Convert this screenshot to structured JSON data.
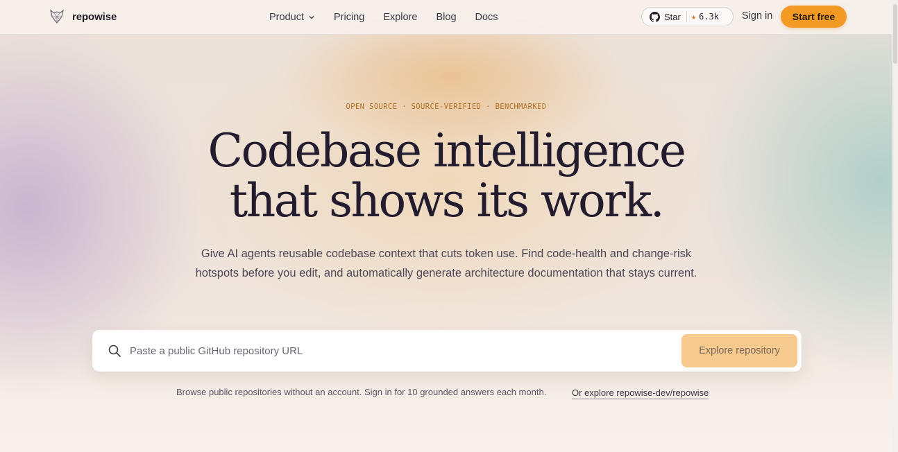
{
  "brand": {
    "name": "repowise",
    "logo_icon": "wolf-logo-icon"
  },
  "nav": {
    "links": [
      {
        "label": "Product",
        "has_dropdown": true
      },
      {
        "label": "Pricing"
      },
      {
        "label": "Explore"
      },
      {
        "label": "Blog"
      },
      {
        "label": "Docs"
      }
    ],
    "github": {
      "star_label": "Star",
      "star_count": "6.3k",
      "icon": "github-icon"
    },
    "signin_label": "Sign in",
    "cta_label": "Start free"
  },
  "hero": {
    "eyebrow": "OPEN SOURCE · SOURCE-VERIFIED · BENCHMARKED",
    "headline_line1": "Codebase intelligence",
    "headline_line2": "that shows its work.",
    "subtext": "Give AI agents reusable codebase context that cuts token use. Find code-health and change-risk hotspots before you edit, and automatically generate architecture documentation that stays current."
  },
  "search": {
    "placeholder": "Paste a public GitHub repository URL",
    "value": "",
    "button_label": "Explore repository"
  },
  "footnote": "Browse public repositories without an account. Sign in for 10 grounded answers each month.",
  "alt_link": "Or explore repowise-dev/repowise",
  "colors": {
    "accent": "#f39a25",
    "accent_disabled": "#f6c98e",
    "eyebrow": "#b06f23"
  }
}
